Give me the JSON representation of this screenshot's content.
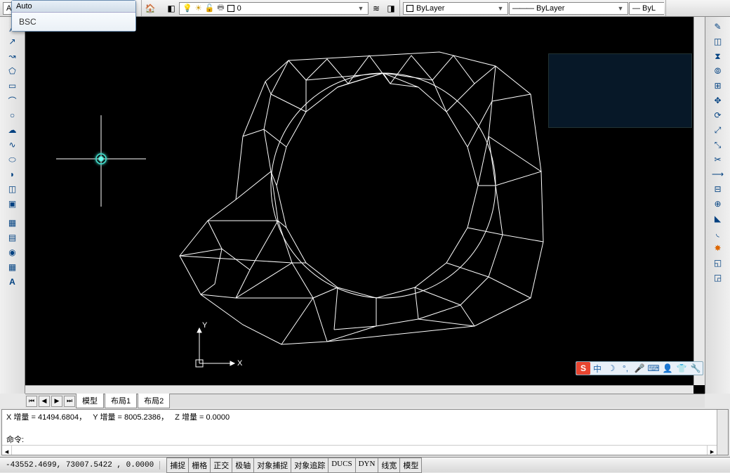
{
  "app": {
    "title": "Auto"
  },
  "popup": {
    "suggestion": "BSC"
  },
  "layer_combo": {
    "label": "0"
  },
  "props": {
    "layer": "ByLayer",
    "linetype": "ByLayer",
    "lineweight": "ByL"
  },
  "tabs": {
    "model": "模型",
    "layout1": "布局1",
    "layout2": "布局2"
  },
  "command": {
    "line1_label_x": "X 增量",
    "line1_val_x": "41494.6804",
    "line1_label_y": "Y 增量",
    "line1_val_y": "8005.2386",
    "line1_label_z": "Z 增量",
    "line1_val_z": "0.0000",
    "prompt": "命令:"
  },
  "status": {
    "coords": "-43552.4699, 73007.5422 , 0.0000",
    "snap": "捕捉",
    "grid": "栅格",
    "ortho": "正交",
    "polar": "极轴",
    "osnap": "对象捕捉",
    "otrack": "对象追踪",
    "ducs": "DUCS",
    "dyn": "DYN",
    "lwt": "线宽",
    "model": "模型"
  },
  "ucs": {
    "x": "X",
    "y": "Y"
  },
  "ime": {
    "lang": "中"
  }
}
